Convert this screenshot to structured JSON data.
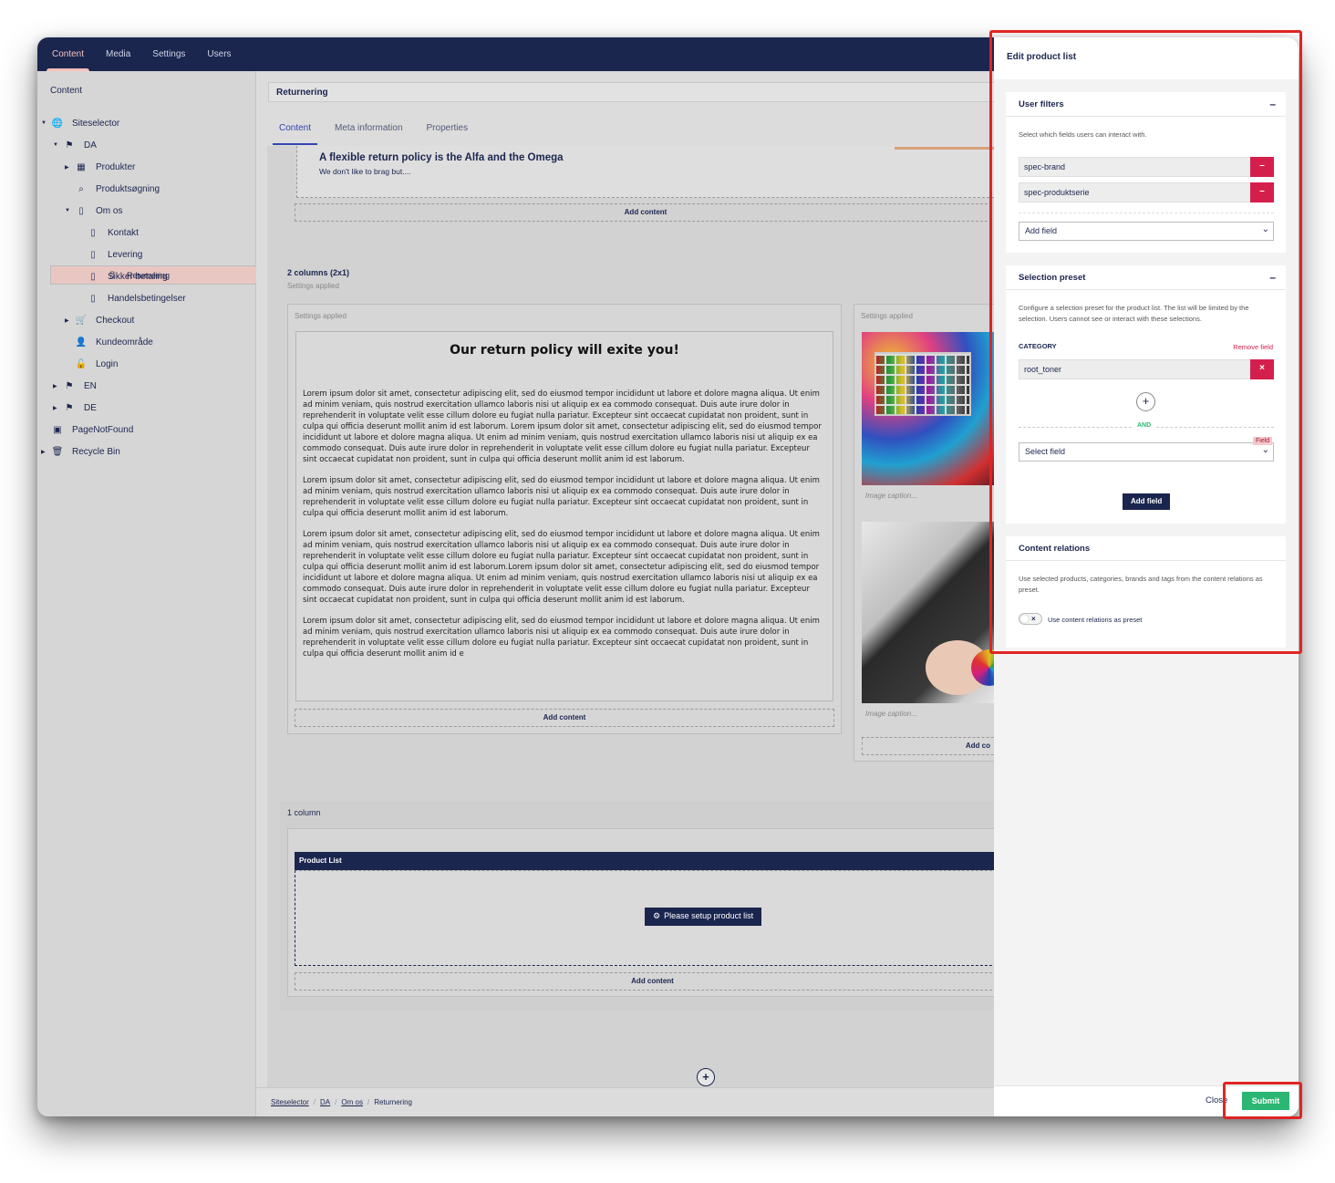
{
  "topnav": [
    "Content",
    "Media",
    "Settings",
    "Users"
  ],
  "sidebar": {
    "title": "Content",
    "tree": [
      {
        "label": "Siteselector",
        "icon": "globe-icon",
        "glyph": "🌐",
        "level": 0,
        "caret": true,
        "open": true
      },
      {
        "label": "DA",
        "icon": "flag-icon",
        "glyph": "⚑",
        "level": 1,
        "caret": true,
        "open": true
      },
      {
        "label": "Produkter",
        "icon": "grid-icon",
        "glyph": "▦",
        "level": 2,
        "caret": true,
        "open": false
      },
      {
        "label": "Produktsøgning",
        "icon": "search-icon",
        "glyph": "⌕",
        "level": 2,
        "caret": false
      },
      {
        "label": "Om os",
        "icon": "document-icon",
        "glyph": "▯",
        "level": 2,
        "caret": true,
        "open": true
      },
      {
        "label": "Kontakt",
        "icon": "document-icon",
        "glyph": "▯",
        "level": 3,
        "caret": false
      },
      {
        "label": "Levering",
        "icon": "document-icon",
        "glyph": "▯",
        "level": 3,
        "caret": false
      },
      {
        "label": "Returnering",
        "icon": "document-icon",
        "glyph": "▯",
        "level": 3,
        "caret": false,
        "selected": true
      },
      {
        "label": "Sikker betaling",
        "icon": "document-icon",
        "glyph": "▯",
        "level": 3,
        "caret": false
      },
      {
        "label": "Handelsbetingelser",
        "icon": "document-icon",
        "glyph": "▯",
        "level": 3,
        "caret": false
      },
      {
        "label": "Checkout",
        "icon": "cart-icon",
        "glyph": "🛒",
        "level": 2,
        "caret": true,
        "open": false
      },
      {
        "label": "Kundeområde",
        "icon": "user-icon",
        "glyph": "👤",
        "level": 2,
        "caret": false
      },
      {
        "label": "Login",
        "icon": "lock-icon",
        "glyph": "🔓",
        "level": 2,
        "caret": false
      },
      {
        "label": "EN",
        "icon": "flag-icon",
        "glyph": "⚑",
        "level": 1,
        "caret": true,
        "open": false
      },
      {
        "label": "DE",
        "icon": "flag-icon",
        "glyph": "⚑",
        "level": 1,
        "caret": true,
        "open": false
      },
      {
        "label": "PageNotFound",
        "icon": "page-not-found-icon",
        "glyph": "▣",
        "level": 0,
        "caret": false
      },
      {
        "label": "Recycle Bin",
        "icon": "trash-icon",
        "glyph": "🗑",
        "level": 0,
        "caret": true,
        "open": false
      }
    ]
  },
  "node_name": "Returnering",
  "tabs": [
    "Content",
    "Meta information",
    "Properties"
  ],
  "editor": {
    "teaser_title": "A flexible return policy is the Alfa and the Omega",
    "teaser_sub": "We don't like to brag but....",
    "add_content": "Add content",
    "row2_title": "2 columns (2x1)",
    "settings_applied": "Settings applied",
    "heading": "Our return policy will exite you!",
    "paragraphs": [
      "Lorem ipsum dolor sit amet, consectetur adipiscing elit, sed do eiusmod tempor incididunt ut labore et dolore magna aliqua. Ut enim ad minim veniam, quis nostrud exercitation ullamco laboris nisi ut aliquip ex ea commodo consequat. Duis aute irure dolor in reprehenderit in voluptate velit esse cillum dolore eu fugiat nulla pariatur. Excepteur sint occaecat cupidatat non proident, sunt in culpa qui officia deserunt mollit anim id est laborum. Lorem ipsum dolor sit amet, consectetur adipiscing elit, sed do eiusmod tempor incididunt ut labore et dolore magna aliqua. Ut enim ad minim veniam, quis nostrud exercitation ullamco laboris nisi ut aliquip ex ea commodo consequat. Duis aute irure dolor in reprehenderit in voluptate velit esse cillum dolore eu fugiat nulla pariatur. Excepteur sint occaecat cupidatat non proident, sunt in culpa qui officia deserunt mollit anim id est laborum.",
      "Lorem ipsum dolor sit amet, consectetur adipiscing elit, sed do eiusmod tempor incididunt ut labore et dolore magna aliqua. Ut enim ad minim veniam, quis nostrud exercitation ullamco laboris nisi ut aliquip ex ea commodo consequat. Duis aute irure dolor in reprehenderit in voluptate velit esse cillum dolore eu fugiat nulla pariatur. Excepteur sint occaecat cupidatat non proident, sunt in culpa qui officia deserunt mollit anim id est laborum.",
      "Lorem ipsum dolor sit amet, consectetur adipiscing elit, sed do eiusmod tempor incididunt ut labore et dolore magna aliqua. Ut enim ad minim veniam, quis nostrud exercitation ullamco laboris nisi ut aliquip ex ea commodo consequat. Duis aute irure dolor in reprehenderit in voluptate velit esse cillum dolore eu fugiat nulla pariatur. Excepteur sint occaecat cupidatat non proident, sunt in culpa qui officia deserunt mollit anim id est laborum.Lorem ipsum dolor sit amet, consectetur adipiscing elit, sed do eiusmod tempor incididunt ut labore et dolore magna aliqua. Ut enim ad minim veniam, quis nostrud exercitation ullamco laboris nisi ut aliquip ex ea commodo consequat. Duis aute irure dolor in reprehenderit in voluptate velit esse cillum dolore eu fugiat nulla pariatur. Excepteur sint occaecat cupidatat non proident, sunt in culpa qui officia deserunt mollit anim id est laborum.",
      "Lorem ipsum dolor sit amet, consectetur adipiscing elit, sed do eiusmod tempor incididunt ut labore et dolore magna aliqua. Ut enim ad minim veniam, quis nostrud exercitation ullamco laboris nisi ut aliquip ex ea commodo consequat. Duis aute irure dolor in reprehenderit in voluptate velit esse cillum dolore eu fugiat nulla pariatur. Excepteur sint occaecat cupidatat non proident, sunt in culpa qui officia deserunt mollit anim id e"
    ],
    "image_caption": "Image caption...",
    "add_content_truncated": "Add co",
    "row3_title": "1 column",
    "product_list_label": "Product List",
    "setup_button": "Please setup product list"
  },
  "breadcrumb": [
    "Siteselector",
    "DA",
    "Om os",
    "Returnering"
  ],
  "panel": {
    "title": "Edit product list",
    "user_filters": {
      "title": "User filters",
      "toggle": "–",
      "desc": "Select which fields users can interact with.",
      "fields": [
        "spec-brand",
        "spec-produktserie"
      ],
      "remove_glyph": "–",
      "add_field": "Add field"
    },
    "selection_preset": {
      "title": "Selection preset",
      "toggle": "–",
      "desc": "Configure a selection preset for the product list. The list will be limited by the selection. Users cannot see or interact with these selections.",
      "category_label": "CATEGORY",
      "remove_field": "Remove field",
      "category_value": "root_toner",
      "remove_glyph": "×",
      "plus": "+",
      "and_label": "AND",
      "field_tag": "Field",
      "select_field": "Select field",
      "add_field_button": "Add field"
    },
    "content_relations": {
      "title": "Content relations",
      "desc": "Use selected products, categories, brands and tags from the content relations as preset.",
      "toggle_label": "Use content relations as preset"
    },
    "close": "Close",
    "submit": "Submit"
  },
  "colors": {
    "navy": "#1b264f",
    "accent_red": "#d41f4c",
    "submit_green": "#2bb673",
    "highlight": "#e02424"
  }
}
